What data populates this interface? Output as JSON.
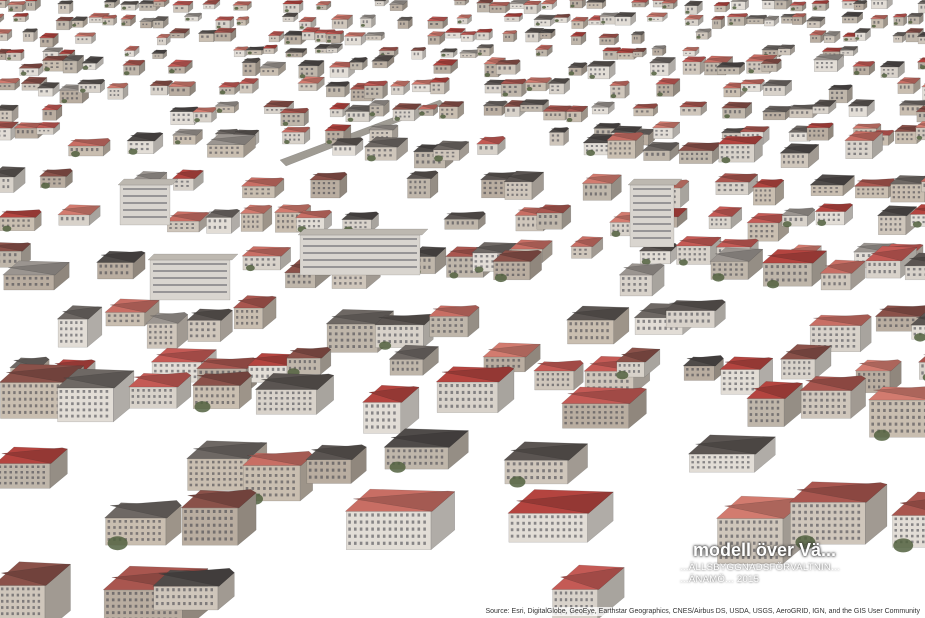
{
  "map": {
    "title": "modell över Vä...",
    "org_line": "...ÄLLSBYGGNADSFÖRVALTNIN...",
    "meta_line": "...ÄNAMÖ... 2015",
    "attribution": "Source: Esri, DigitalGlobe, GeoEye, Earthstar Geographics, CNES/Airbus DS, USDA, USGS, AeroGRID, IGN, and the GIS User Community"
  },
  "colors": {
    "ground": "#ffffff",
    "roof_red": "#c0504f",
    "roof_dark": "#55504c",
    "wall_light": "#d6d0c8",
    "tree": "#4d5a3a"
  }
}
